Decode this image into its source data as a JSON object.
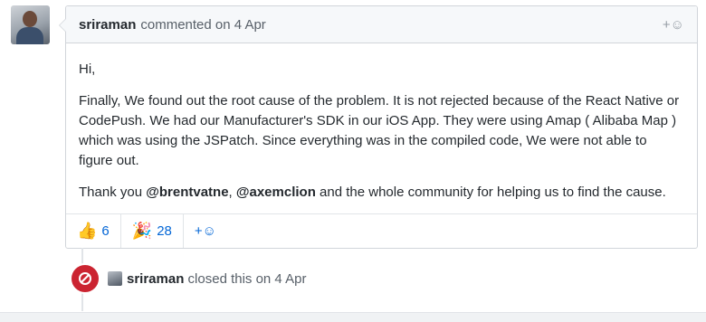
{
  "comment": {
    "author": "sriraman",
    "meta": "commented on 4 Apr",
    "add_reaction_label": "+☺",
    "body": {
      "greeting": "Hi,",
      "paragraph": "Finally, We found out the root cause of the problem. It is not rejected because of the React Native or CodePush. We had our Manufacturer's SDK in our iOS App. They were using Amap ( Alibaba Map ) which was using the JSPatch. Since everything was in the compiled code, We were not able to figure out.",
      "thanks_prefix": "Thank you ",
      "mention_1": "@brentvatne",
      "separator": ", ",
      "mention_2": "@axemclion",
      "thanks_suffix": " and the whole community for helping us to find the cause."
    },
    "reactions": [
      {
        "icon": "thumbs-up-icon",
        "glyph": "👍",
        "count": "6"
      },
      {
        "icon": "hooray-icon",
        "glyph": "🎉",
        "count": "28"
      }
    ],
    "add_reaction_bottom": "+☺"
  },
  "event": {
    "icon": "closed-circle-icon",
    "actor": "sriraman",
    "text": "closed this on 4 Apr"
  },
  "colors": {
    "closed_badge": "#cb2431",
    "link": "#0366d6"
  }
}
